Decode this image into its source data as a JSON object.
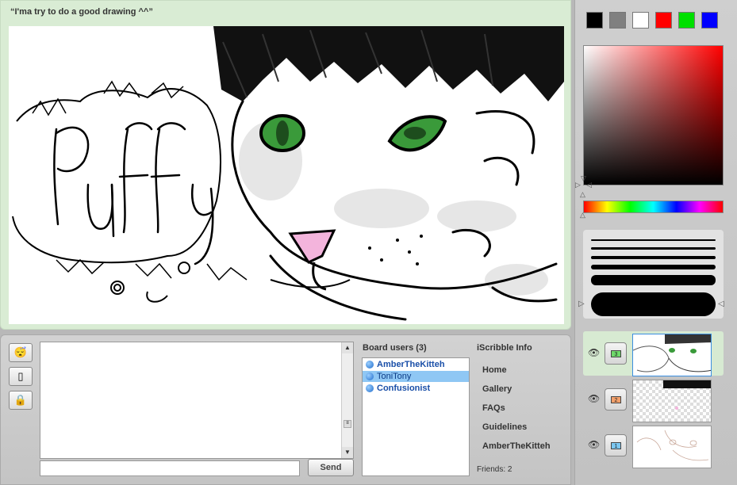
{
  "drawing": {
    "title": "“I'ma try to do a good drawing ^^”",
    "canvas_text": "PuFFy"
  },
  "palette": {
    "swatches": [
      {
        "name": "black-swatch",
        "color": "#000000"
      },
      {
        "name": "gray-swatch",
        "color": "#808080"
      },
      {
        "name": "white-swatch",
        "color": "#ffffff"
      },
      {
        "name": "red-swatch",
        "color": "#ff0000"
      },
      {
        "name": "green-swatch",
        "color": "#00e000"
      },
      {
        "name": "blue-swatch",
        "color": "#0000ff"
      }
    ],
    "picker_hue": "#ff0000"
  },
  "brush_sizes": {
    "count": 6,
    "selected_index": 5
  },
  "layers": [
    {
      "number": "3",
      "badge_color": "#6fd96b",
      "active": true
    },
    {
      "number": "2",
      "badge_color": "#f3a06b",
      "active": false
    },
    {
      "number": "1",
      "badge_color": "#7cc7f0",
      "active": false
    }
  ],
  "icons": {
    "layer_eye": "eye-icon",
    "tools": [
      "sleepy-smiley-icon",
      "notepad-icon",
      "lock-icon"
    ]
  },
  "chat": {
    "input_value": "",
    "send_label": "Send"
  },
  "board_users": {
    "title": "Board users (3)",
    "users": [
      {
        "name": "AmberTheKitteh",
        "selected": false
      },
      {
        "name": "ToniTony",
        "selected": true
      },
      {
        "name": "Confusionist",
        "selected": false
      }
    ]
  },
  "info": {
    "title": "iScribble Info",
    "links": [
      "Home",
      "Gallery",
      "FAQs",
      "Guidelines",
      "AmberTheKitteh"
    ],
    "friends": "Friends: 2"
  }
}
